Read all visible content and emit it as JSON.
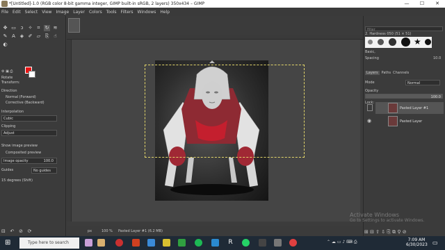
{
  "window": {
    "title": "*[Untitled]-1.0 (RGB color 8-bit gamma integer, GIMP built-in sRGB, 2 layers) 350x434 – GIMP",
    "minimize": "—",
    "maximize": "☐",
    "close": "✕"
  },
  "menu": [
    "File",
    "Edit",
    "Select",
    "View",
    "Image",
    "Layer",
    "Colors",
    "Tools",
    "Filters",
    "Windows",
    "Help"
  ],
  "tool_options": {
    "title": "Rotate",
    "transform_label": "Transform:",
    "direction_label": "Direction",
    "direction_normal": "Normal (Forward)",
    "direction_corrective": "Corrective (Backward)",
    "interpolation_label": "Interpolation",
    "interpolation_value": "Cubic",
    "clipping_label": "Clipping",
    "clipping_value": "Adjust",
    "show_preview": "Show image preview",
    "composited_preview": "Composited preview",
    "image_opacity_label": "Image opacity",
    "image_opacity_value": "100.0",
    "guides_label": "Guides",
    "guides_value": "No guides",
    "snap_label": "15 degrees (Shift)"
  },
  "brushes": {
    "filter_placeholder": "filter",
    "brush_name": "2. Hardness 050 (51 × 51)",
    "preset": "Basic,",
    "spacing_label": "Spacing",
    "spacing_value": "10.0"
  },
  "layers_panel": {
    "tabs": [
      "Layers",
      "Paths",
      "Channels"
    ],
    "mode_label": "Mode",
    "mode_value": "Normal",
    "opacity_label": "Opacity",
    "opacity_value": "100.0",
    "lock_label": "Lock:",
    "layers": [
      {
        "name": "Pasted Layer #1",
        "selected": true
      },
      {
        "name": "Pasted Layer",
        "selected": false
      }
    ]
  },
  "status": {
    "unit": "px",
    "zoom": "100 %",
    "layer_info": "Pasted Layer #1 (6.2 MB)"
  },
  "watermark": {
    "title": "Activate Windows",
    "subtitle": "Go to Settings to activate Windows."
  },
  "taskbar": {
    "search_placeholder": "Type here to search",
    "time": "7:09 AM",
    "date": "6/30/2023"
  },
  "colors": {
    "foreground": "#e81414",
    "background": "#ffffff",
    "selection": "#e3d66a"
  }
}
